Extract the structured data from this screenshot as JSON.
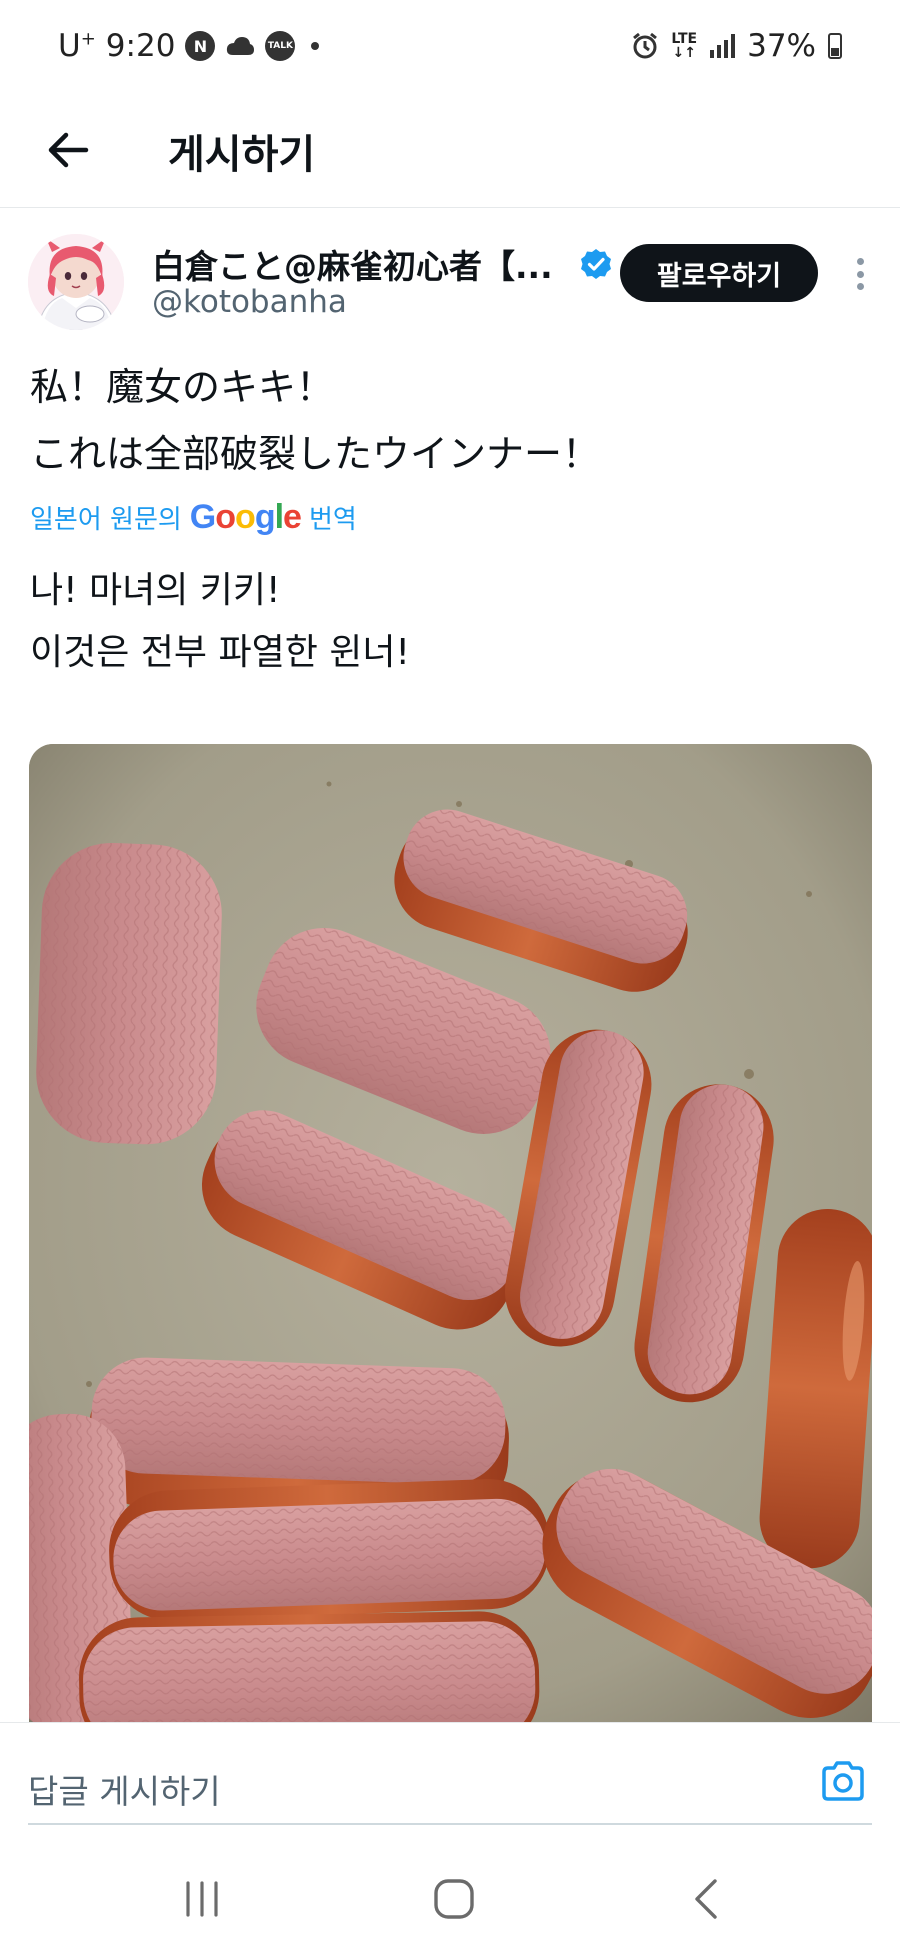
{
  "status_bar": {
    "carrier": "U",
    "carrier_sup": "+",
    "time": "9:20",
    "badge_n": "N",
    "badge_talk": "TALK",
    "network_top": "LTE",
    "network_bottom": "↓↑",
    "battery": "37%"
  },
  "header": {
    "title": "게시하기"
  },
  "post": {
    "author_name": "白倉こと@麻雀初心者【...",
    "author_handle": "@kotobanha",
    "follow_label": "팔로우하기",
    "original_lines": [
      "私！魔女のキキ！",
      "これは全部破裂したウインナー！"
    ],
    "translate_prefix": "일본어 원문의",
    "translate_brand": "Google",
    "translate_suffix": "번역",
    "translated_lines": [
      "나! 마녀의 키키!",
      "이것은 전부 파열한 윈너!"
    ]
  },
  "reply": {
    "placeholder": "답글 게시하기"
  },
  "icons": {
    "back": "arrow-left-icon",
    "verified": "verified-badge-icon",
    "more": "more-vertical-icon",
    "camera": "camera-icon",
    "recents": "recents-icon",
    "home": "home-icon",
    "nav_back": "chevron-left-icon"
  },
  "colors": {
    "accent": "#1d9bf0",
    "follow_bg": "#0f1419",
    "secondary_text": "#536471"
  }
}
